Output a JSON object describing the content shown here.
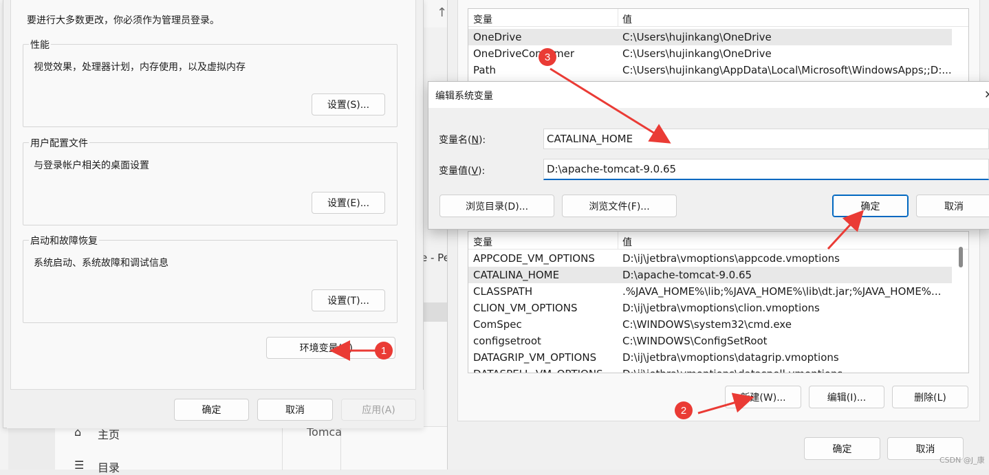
{
  "system_properties": {
    "admin_note": "要进行大多数更改，你必须作为管理员登录。",
    "performance": {
      "title": "性能",
      "desc": "视觉效果，处理器计划，内存使用，以及虚拟内存",
      "button": "设置(S)..."
    },
    "user_profiles": {
      "title": "用户配置文件",
      "desc": "与登录帐户相关的桌面设置",
      "button": "设置(E)..."
    },
    "startup": {
      "title": "启动和故障恢复",
      "desc": "系统启动、系统故障和调试信息",
      "button": "设置(T)..."
    },
    "env_button": "环境变量(N)...",
    "ok": "确定",
    "cancel": "取消",
    "apply": "应用(A)"
  },
  "background": {
    "arrow_up": "↑",
    "partial_text": "e - Pe",
    "home_label": "主页",
    "catalog_label": "目录",
    "tomcat_partial": "Tomca"
  },
  "env_vars": {
    "user_header": {
      "name": "变量",
      "value": "值"
    },
    "user_rows": [
      {
        "name": "OneDrive",
        "value": "C:\\Users\\hujinkang\\OneDrive"
      },
      {
        "name": "OneDriveConsumer",
        "value": "C:\\Users\\hujinkang\\OneDrive"
      },
      {
        "name": "Path",
        "value": "C:\\Users\\hujinkang\\AppData\\Local\\Microsoft\\WindowsApps;;D:..."
      }
    ],
    "system_header": {
      "name": "变量",
      "value": "值"
    },
    "system_rows": [
      {
        "name": "APPCODE_VM_OPTIONS",
        "value": "D:\\ij\\jetbra\\vmoptions\\appcode.vmoptions"
      },
      {
        "name": "CATALINA_HOME",
        "value": "D:\\apache-tomcat-9.0.65"
      },
      {
        "name": "CLASSPATH",
        "value": ".%JAVA_HOME%\\lib;%JAVA_HOME%\\lib\\dt.jar;%JAVA_HOME%..."
      },
      {
        "name": "CLION_VM_OPTIONS",
        "value": "D:\\ij\\jetbra\\vmoptions\\clion.vmoptions"
      },
      {
        "name": "ComSpec",
        "value": "C:\\WINDOWS\\system32\\cmd.exe"
      },
      {
        "name": "configsetroot",
        "value": "C:\\WINDOWS\\ConfigSetRoot"
      },
      {
        "name": "DATAGRIP_VM_OPTIONS",
        "value": "D:\\ij\\jetbra\\vmoptions\\datagrip.vmoptions"
      },
      {
        "name": "DATASPELL_VM_OPTIONS",
        "value": "D:\\ij\\jetbra\\vmoptions\\dataspell.vmoptions"
      }
    ],
    "new_button": "新建(W)...",
    "edit_button": "编辑(I)...",
    "delete_button": "删除(L)",
    "ok": "确定",
    "cancel": "取消"
  },
  "edit_dialog": {
    "title": "编辑系统变量",
    "close_glyph": "✕",
    "name_label_prefix": "变量名(",
    "name_label_key": "N",
    "name_label_suffix": "):",
    "value_label_prefix": "变量值(",
    "value_label_key": "V",
    "value_label_suffix": "):",
    "name_value": "CATALINA_HOME",
    "value_value": "D:\\apache-tomcat-9.0.65",
    "browse_dir": "浏览目录(D)...",
    "browse_file": "浏览文件(F)...",
    "ok": "确定",
    "cancel": "取消"
  },
  "annotations": {
    "step1": "1",
    "step2": "2",
    "step3": "3",
    "color": "#ea3b35"
  },
  "watermark": "CSDN @J_康"
}
